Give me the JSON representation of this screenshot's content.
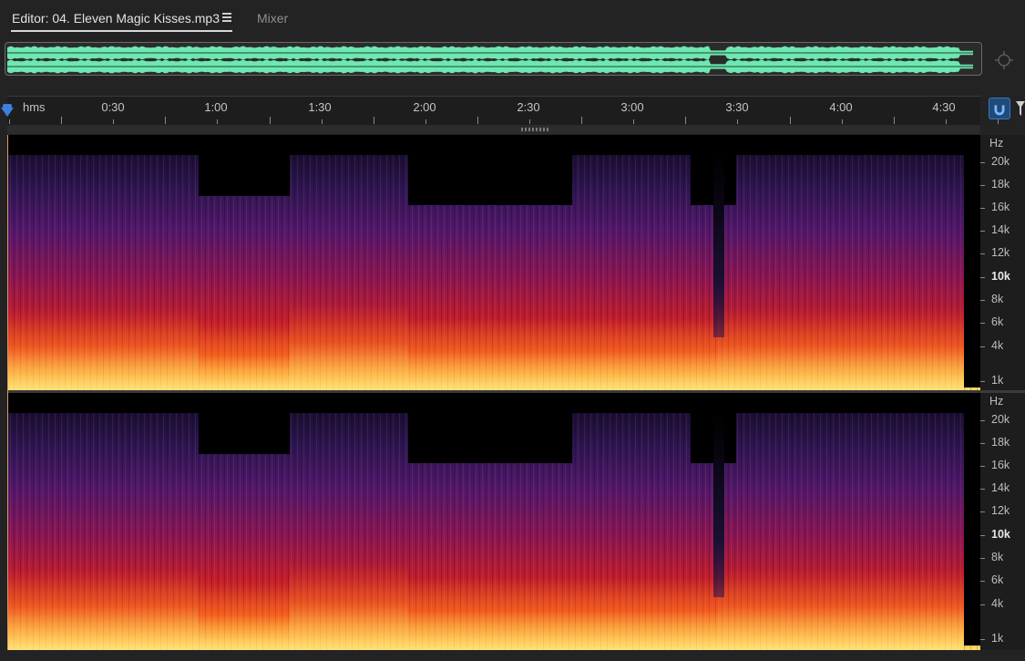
{
  "tabs": {
    "editor_label": "Editor: 04. Eleven Magic Kisses.mp3",
    "menu_icon": "hamburger-menu-icon",
    "mixer_label": "Mixer"
  },
  "overview": {
    "waveform_color": "#6ee8b0",
    "zoom_icon": "zoom-navigator-icon"
  },
  "ruler": {
    "unit": "hms",
    "labels": [
      "0:30",
      "1:00",
      "1:30",
      "2:00",
      "2:30",
      "3:00",
      "3:30",
      "4:00",
      "4:30"
    ]
  },
  "toolbar": {
    "snap_icon": "magnet-snap-icon",
    "filter_icon": "filter-icon"
  },
  "spectral": {
    "hz_unit": "Hz",
    "freq_labels": [
      "20k",
      "18k",
      "16k",
      "14k",
      "12k",
      "10k",
      "8k",
      "6k",
      "4k",
      "1k"
    ],
    "colors": {
      "high": "#ffe070",
      "mid": "#ec4b1a",
      "low": "#52176c",
      "background": "#000000"
    }
  }
}
